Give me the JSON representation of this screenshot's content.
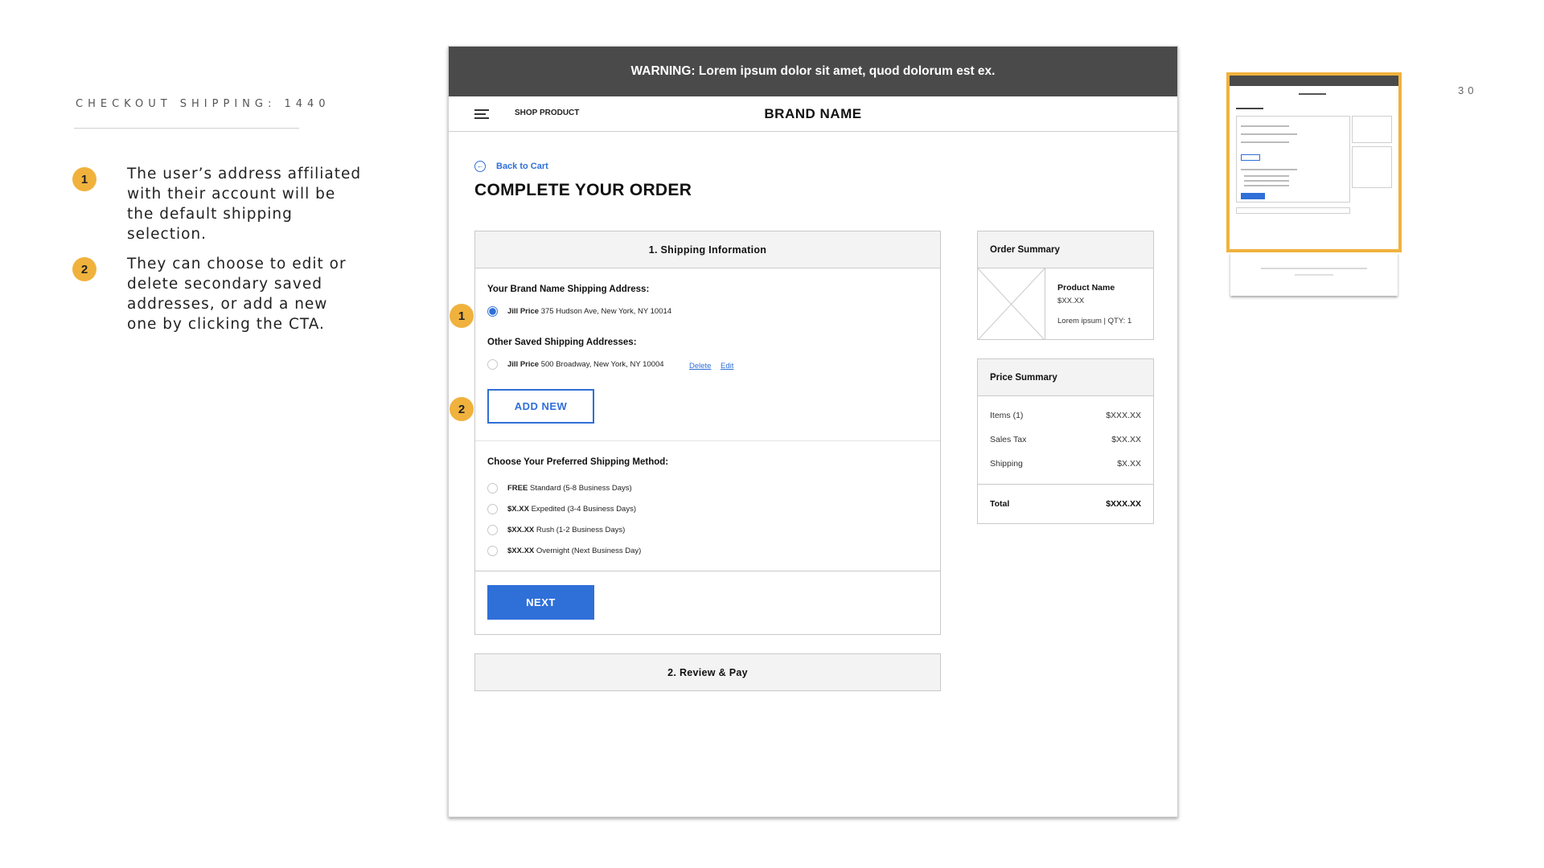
{
  "slide": {
    "title": "CHECKOUT SHIPPING: 1440",
    "page_number": "30",
    "notes": [
      {
        "badge": "1",
        "text": "The user’s address affiliated with their account will be the default shipping selection."
      },
      {
        "badge": "2",
        "text": "They can choose to edit or delete secondary saved addresses, or add a new one by clicking the CTA."
      }
    ]
  },
  "mockup": {
    "warning": "WARNING: Lorem ipsum dolor sit amet, quod dolorum est ex.",
    "nav": {
      "shop_link": "SHOP PRODUCT",
      "brand": "BRAND NAME"
    },
    "back_link": "Back to Cart",
    "page_title": "COMPLETE YOUR ORDER",
    "shipping": {
      "header": "1. Shipping Information",
      "default_label": "Your Brand Name Shipping Address:",
      "default_address": {
        "name": "Jill Price",
        "address": "375 Hudson Ave, New York, NY 10014"
      },
      "other_label": "Other Saved Shipping Addresses:",
      "other_address": {
        "name": "Jill Price",
        "address": "500 Broadway, New York, NY 10004"
      },
      "delete_label": "Delete",
      "edit_label": "Edit",
      "add_new_label": "ADD NEW",
      "method_label": "Choose Your Preferred Shipping Method:",
      "methods": [
        {
          "price": "FREE",
          "desc": "Standard (5-8 Business Days)"
        },
        {
          "price": "$X.XX",
          "desc": "Expedited (3-4 Business Days)"
        },
        {
          "price": "$XX.XX",
          "desc": "Rush (1-2 Business Days)"
        },
        {
          "price": "$XX.XX",
          "desc": "Overnight (Next Business Day)"
        }
      ],
      "next_label": "NEXT"
    },
    "review": {
      "header": "2. Review & Pay"
    },
    "order_summary": {
      "header": "Order Summary",
      "product_name": "Product Name",
      "product_price": "$XX.XX",
      "product_meta": "Lorem ipsum | QTY: 1"
    },
    "price_summary": {
      "header": "Price Summary",
      "rows": [
        {
          "label": "Items (1)",
          "value": "$XXX.XX"
        },
        {
          "label": "Sales Tax",
          "value": "$XX.XX"
        },
        {
          "label": "Shipping",
          "value": "$X.XX"
        }
      ],
      "total": {
        "label": "Total",
        "value": "$XXX.XX"
      }
    },
    "badges": [
      "1",
      "2"
    ]
  },
  "colors": {
    "accent": "#2f6fd8",
    "badge": "#f0b23d",
    "warning_bg": "#4a4a4a"
  }
}
